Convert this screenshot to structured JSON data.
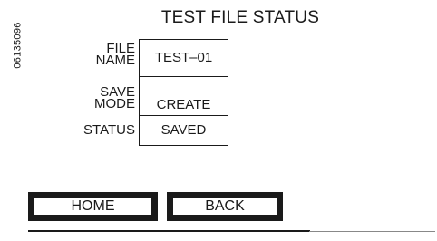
{
  "figure_code": "06135096",
  "title": "TEST FILE STATUS",
  "fields": [
    {
      "label_line1": "FILE",
      "label_line2": "NAME",
      "value": "TEST–01"
    },
    {
      "label_line1": "SAVE",
      "label_line2": "MODE",
      "value": "CREATE"
    },
    {
      "label_line1": "STATUS",
      "label_line2": "",
      "value": "SAVED"
    }
  ],
  "buttons": {
    "home": "HOME",
    "back": "BACK"
  }
}
